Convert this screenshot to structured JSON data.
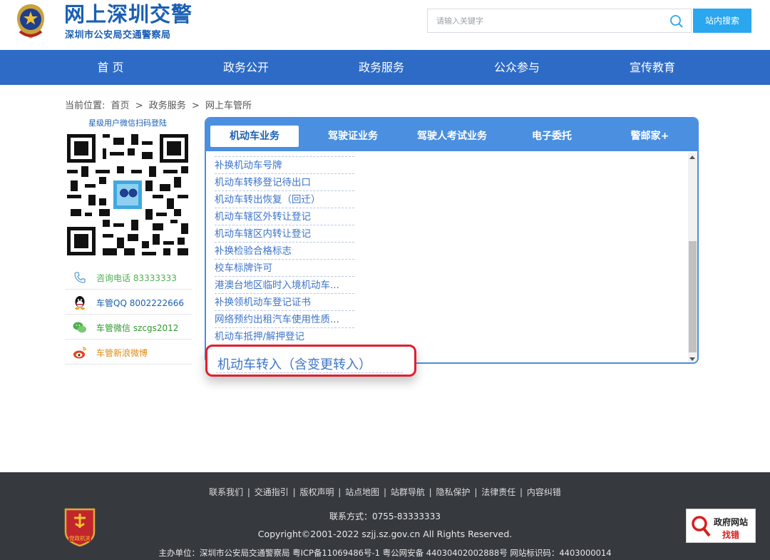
{
  "header": {
    "title": "网上深圳交警",
    "subtitle": "深圳市公安局交通警察局",
    "search_placeholder": "请输入关键字",
    "search_button": "站内搜索"
  },
  "nav": {
    "items": [
      {
        "label": "首  页"
      },
      {
        "label": "政务公开"
      },
      {
        "label": "政务服务"
      },
      {
        "label": "公众参与"
      },
      {
        "label": "宣传教育"
      }
    ]
  },
  "breadcrumb": {
    "prefix": "当前位置:",
    "items": [
      "首页",
      ">",
      "政务服务",
      ">",
      "网上车管所"
    ]
  },
  "left": {
    "qr_title": "星级用户微信扫码登陆",
    "contacts": [
      {
        "text": "咨询电话 83333333",
        "icon": "phone-icon",
        "color": "#4caf50"
      },
      {
        "text": "车管QQ 8002222666",
        "icon": "qq-icon",
        "color": "#1a5fb4"
      },
      {
        "text": "车管微信 szcgs2012",
        "icon": "wechat-icon",
        "color": "#2e9a2e"
      },
      {
        "text": "车管新浪微博",
        "icon": "weibo-icon",
        "color": "#e08a12"
      }
    ]
  },
  "panel": {
    "tabs": [
      {
        "label": "机动车业务",
        "active": true
      },
      {
        "label": "驾驶证业务",
        "active": false
      },
      {
        "label": "驾驶人考试业务",
        "active": false
      },
      {
        "label": "电子委托",
        "active": false
      },
      {
        "label": "警邮家+",
        "active": false
      }
    ],
    "items": [
      "补换机动车号牌",
      "机动车转移登记待出口",
      "机动车转出恢复（回迁）",
      "机动车辖区外转让登记",
      "机动车辖区内转让登记",
      "补换检验合格标志",
      "校车标牌许可",
      "港澳台地区临时入境机动车...",
      "补换领机动车登记证书",
      "网络预约出租汽车使用性质...",
      "机动车抵押/解押登记"
    ],
    "highlighted_item": "机动车转入（含变更转入）"
  },
  "footer": {
    "links": [
      "联系我们",
      "交通指引",
      "版权声明",
      "站点地图",
      "站群导航",
      "隐私保护",
      "法律责任",
      "内容纠错"
    ],
    "contact": "联系方式：0755-83333333",
    "copyright": "Copyright©2001-2022 szjj.sz.gov.cn    All Rights Reserved.",
    "host": "主办单位：深圳市公安局交通警察局  粤ICP备11069486号-1  粤公网安备 44030402002888号  网站标识码：4403000014",
    "party_badge": "党政机关",
    "gov_badge_line1": "政府网站",
    "gov_badge_line2": "找错"
  },
  "colors": {
    "brand_blue": "#1a5fb4",
    "nav_blue": "#2d6bc7",
    "tab_blue": "#4a8fe0",
    "search_button": "#2aa7ee",
    "highlight_red": "#e02030",
    "footer_bg": "#363a3f"
  }
}
